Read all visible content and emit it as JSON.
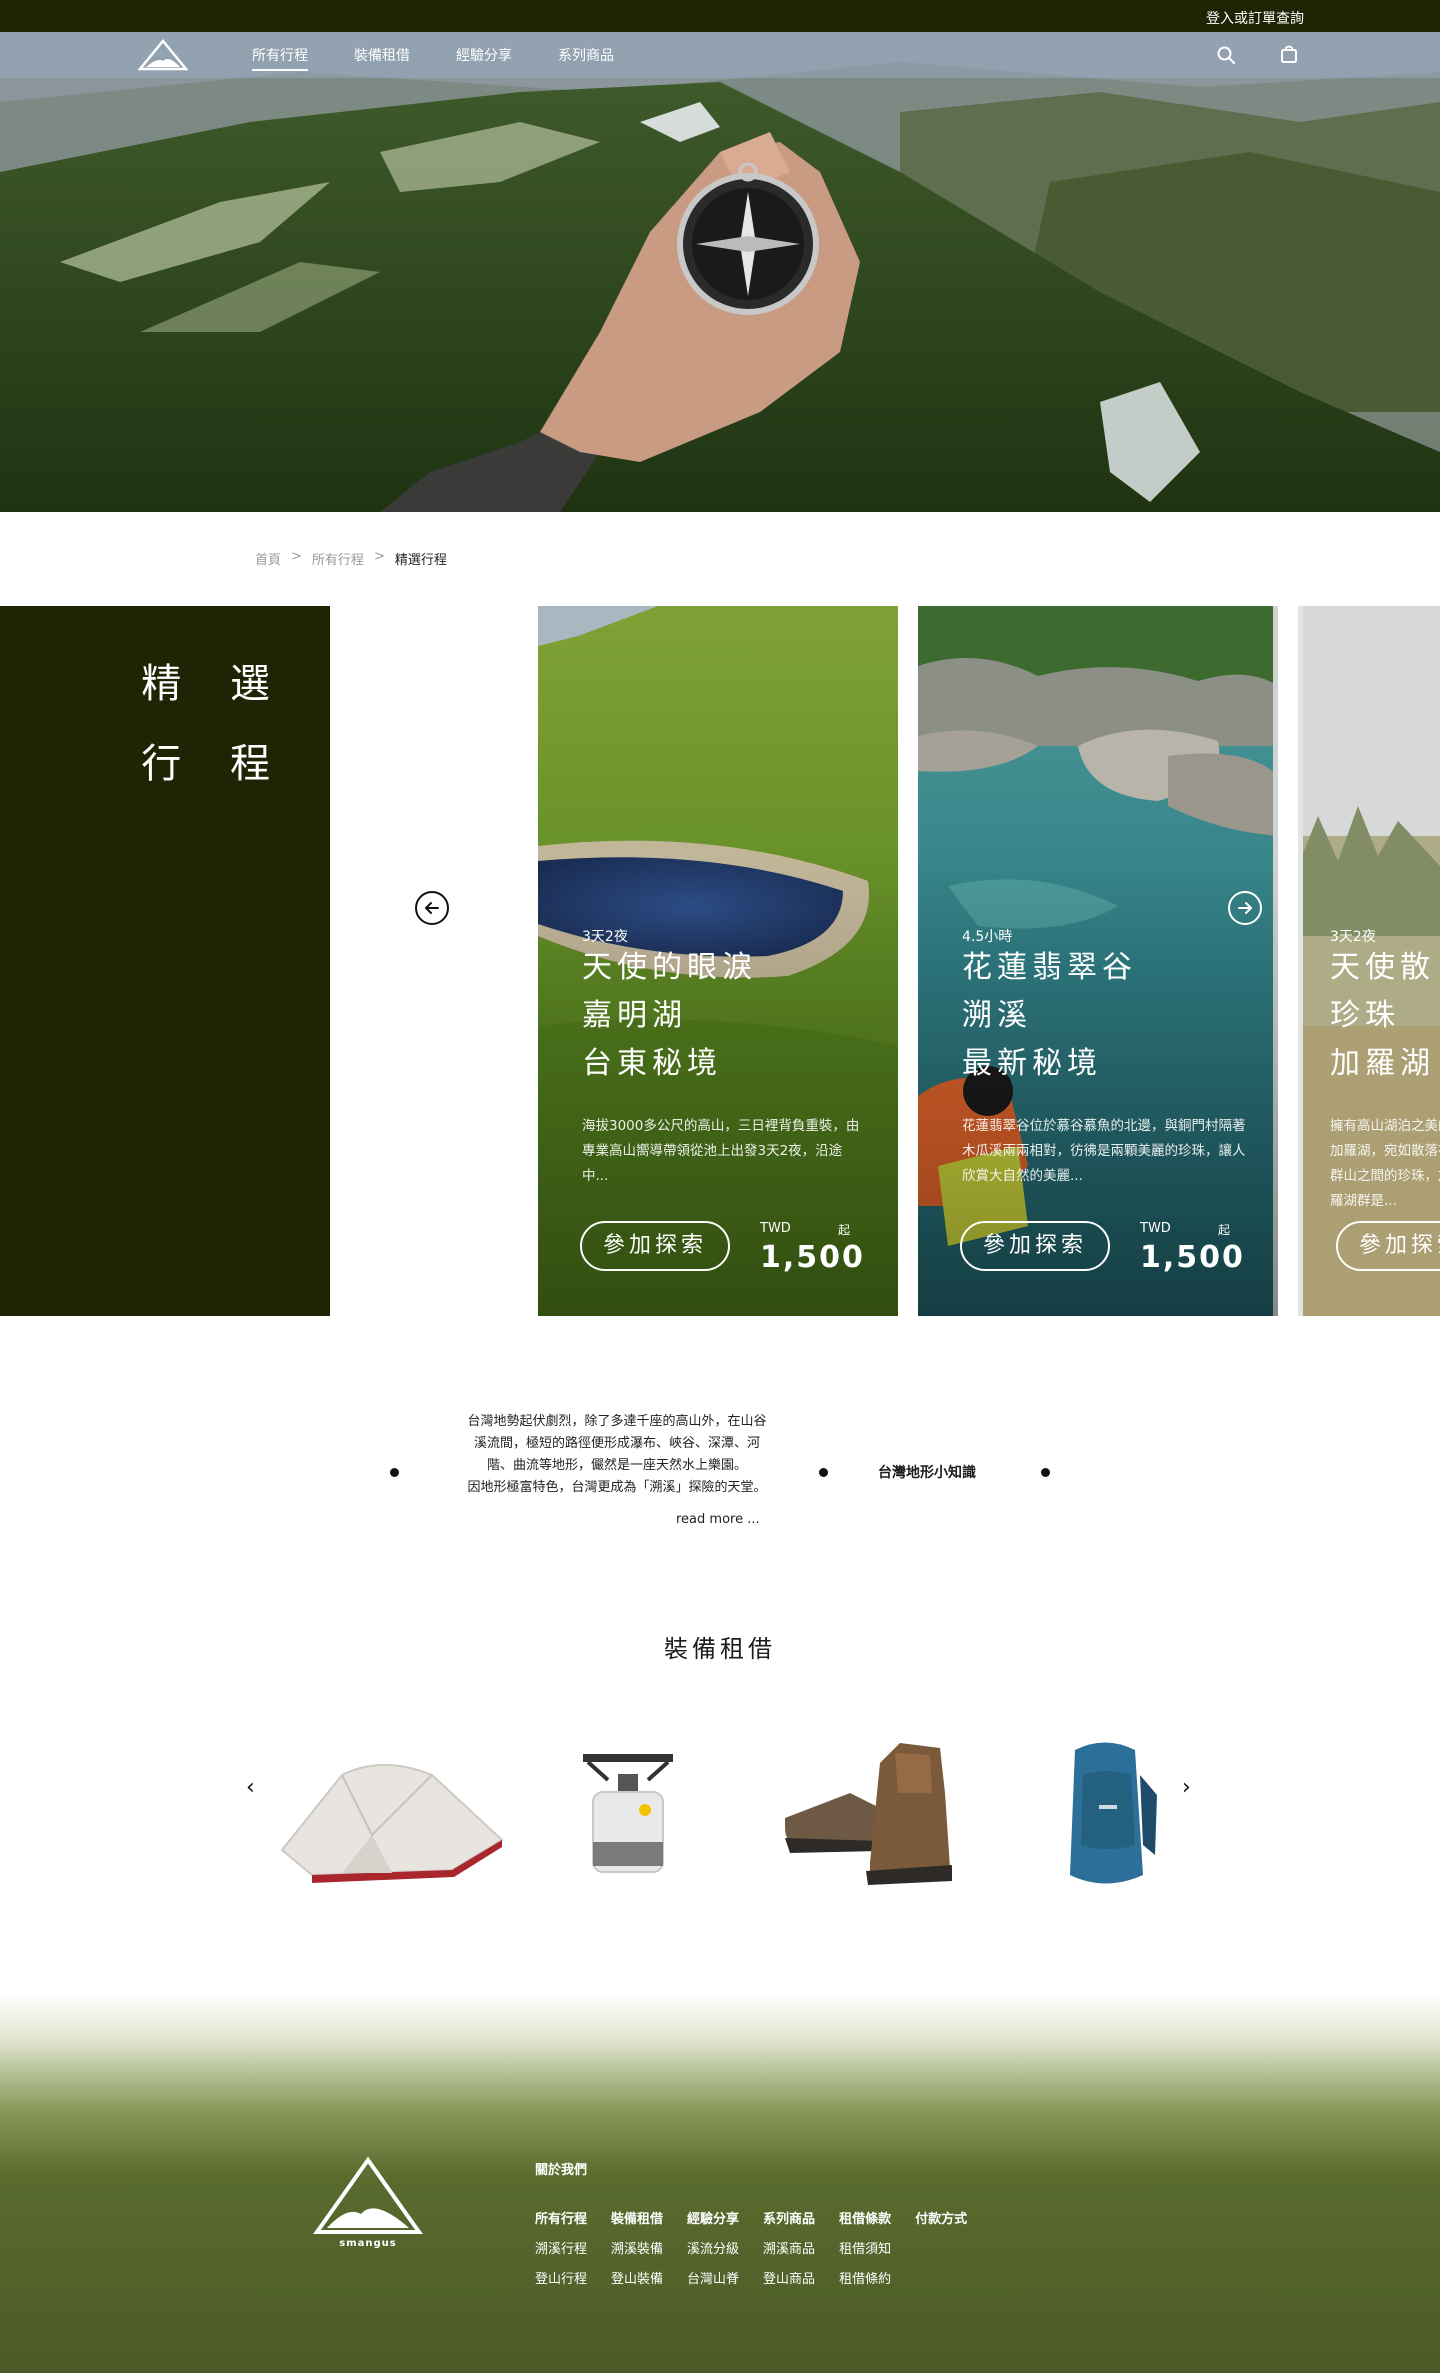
{
  "topbar": {
    "login_text": "登入或訂單查詢"
  },
  "nav": {
    "links": [
      "所有行程",
      "裝備租借",
      "經驗分享",
      "系列商品"
    ],
    "active_index": 0,
    "search_icon": "search-icon",
    "cart_icon": "shopping-bag-icon"
  },
  "breadcrumb": {
    "items": [
      "首頁",
      "所有行程",
      "精選行程"
    ],
    "separator": ">"
  },
  "featured": {
    "title_line1": "精 選",
    "title_line2": "行 程",
    "cards": [
      {
        "duration": "3天2夜",
        "title_lines": [
          "天使的眼淚",
          "嘉明湖",
          "台東秘境"
        ],
        "description": "海拔3000多公尺的高山，三日裡背負重裝，由專業高山嚮導帶領從池上出發3天2夜，沿途中...",
        "button": "參加探索",
        "currency": "TWD",
        "from": "起",
        "price": "1,500"
      },
      {
        "duration": "4.5小時",
        "title_lines": [
          "花蓮翡翠谷",
          "溯溪",
          "最新秘境"
        ],
        "description": "花蓮翡翠谷位於慕谷慕魚的北邊，與銅門村隔著木瓜溪兩兩相對，彷彿是兩顆美麗的珍珠，讓人欣賞大自然的美麗...",
        "button": "參加探索",
        "currency": "TWD",
        "from": "起",
        "price": "1,500"
      },
      {
        "duration": "3天2夜",
        "title_lines": [
          "天使散",
          "珍珠",
          "加羅湖"
        ],
        "description": "擁有高山湖泊之美的加羅湖，宛如散落在群山之間的珍珠，加羅湖群是...",
        "button": "參加探索"
      }
    ]
  },
  "knowledge": {
    "lines": [
      "台灣地勢起伏劇烈，除了多達千座的高山外，在山谷",
      "溪流間，極短的路徑便形成瀑布、峽谷、深潭、河",
      "階、曲流等地形，儼然是一座天然水上樂園。",
      "因地形極富特色，台灣更成為「溯溪」探險的天堂。"
    ],
    "read_more": "read more ...",
    "label": "台灣地形小知識"
  },
  "gear": {
    "title": "裝備租借",
    "prev": "‹",
    "next": "›",
    "items": [
      "tent",
      "gas-stove",
      "hiking-boots",
      "backpack"
    ]
  },
  "footer": {
    "wordmark": "smangus",
    "about": "關於我們",
    "columns": [
      {
        "head": "所有行程",
        "items": [
          "溯溪行程",
          "登山行程"
        ]
      },
      {
        "head": "裝備租借",
        "items": [
          "溯溪裝備",
          "登山裝備"
        ]
      },
      {
        "head": "經驗分享",
        "items": [
          "溪流分級",
          "台灣山脊"
        ]
      },
      {
        "head": "系列商品",
        "items": [
          "溯溪商品",
          "登山商品"
        ]
      },
      {
        "head": "租借條款",
        "items": [
          "租借須知",
          "租借條約"
        ]
      },
      {
        "head": "付款方式",
        "items": []
      }
    ]
  },
  "colors": {
    "dark_green": "#1e2505",
    "footer_green": "#4b5a28"
  }
}
